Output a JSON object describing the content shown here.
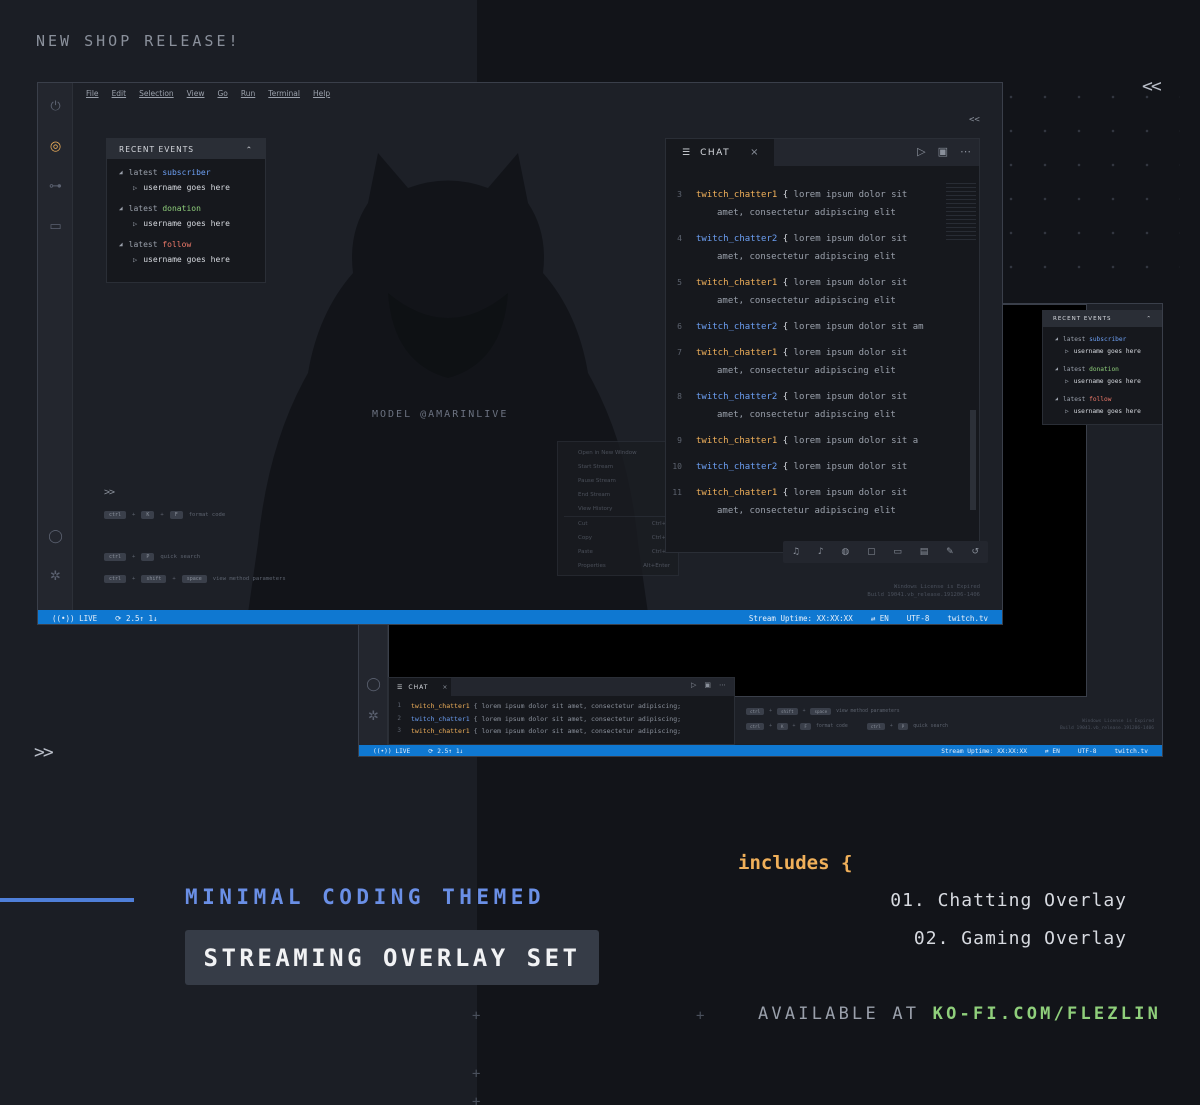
{
  "promo": {
    "top_label": "NEW SHOP RELEASE!",
    "chevron_left": "<<",
    "chevron_right": ">>",
    "theme_title": "MINIMAL CODING THEMED",
    "set_title": "STREAMING OVERLAY SET",
    "includes_label": "includes {",
    "includes_items": [
      "01. Chatting Overlay",
      "02. Gaming Overlay"
    ],
    "available_prefix": "AVAILABLE AT ",
    "available_url": "KO-FI.COM/FLEZLIN",
    "accent_color": "#6a8fe6",
    "orange_color": "#f0b05a",
    "green_color": "#8fcf7b"
  },
  "window_a": {
    "menu": [
      "File",
      "Edit",
      "Selection",
      "View",
      "Go",
      "Run",
      "Terminal",
      "Help"
    ],
    "activity_icons": [
      "power-icon",
      "webcam-icon",
      "gamepad-icon",
      "inbox-icon",
      "account-icon",
      "settings-icon"
    ],
    "model_tag": "MODEL @AMARINLIVE",
    "collapse_icon": "<<",
    "events": {
      "header": "RECENT EVENTS",
      "items": [
        {
          "prefix": "latest ",
          "type": "subscriber",
          "value": "username goes here"
        },
        {
          "prefix": "latest ",
          "type": "donation",
          "value": "username goes here"
        },
        {
          "prefix": "latest ",
          "type": "follow",
          "value": "username goes here"
        }
      ]
    },
    "prompt": ">>",
    "shortcuts": [
      {
        "keys": [
          "ctrl",
          "K",
          "F"
        ],
        "label": "format code"
      },
      {
        "keys": [
          "ctrl",
          "P"
        ],
        "label": "quick search"
      },
      {
        "keys": [
          "ctrl",
          "shift",
          "space"
        ],
        "label": "view method parameters"
      }
    ],
    "context_menu": [
      {
        "label": "Open in New Window",
        "shortcut": ""
      },
      {
        "label": "Start Stream",
        "shortcut": ""
      },
      {
        "label": "Pause Stream",
        "shortcut": ""
      },
      {
        "label": "End Stream",
        "shortcut": ""
      },
      {
        "label": "View History",
        "shortcut": ""
      },
      {
        "label": "Cut",
        "shortcut": "Ctrl+X"
      },
      {
        "label": "Copy",
        "shortcut": "Ctrl+C"
      },
      {
        "label": "Paste",
        "shortcut": "Ctrl+V"
      },
      {
        "label": "Properties",
        "shortcut": "Alt+Enter"
      }
    ],
    "chat": {
      "tab_label": "CHAT",
      "close_icon": "×",
      "lines": [
        {
          "n": "3",
          "user": "twitch_chatter1",
          "text": "lorem  ipsum dolor sit",
          "cont": "amet, consectetur adipiscing elit"
        },
        {
          "n": "4",
          "user": "twitch_chatter2",
          "text": "lorem  ipsum dolor sit",
          "cont": "amet, consectetur adipiscing elit"
        },
        {
          "n": "5",
          "user": "twitch_chatter1",
          "text": "lorem  ipsum dolor sit",
          "cont": "amet, consectetur adipiscing elit"
        },
        {
          "n": "6",
          "user": "twitch_chatter2",
          "text": "lorem ipsum dolor sit am",
          "cont": ""
        },
        {
          "n": "7",
          "user": "twitch_chatter1",
          "text": "lorem  ipsum dolor sit",
          "cont": "amet, consectetur adipiscing elit"
        },
        {
          "n": "8",
          "user": "twitch_chatter2",
          "text": "lorem  ipsum dolor sit",
          "cont": "amet, consectetur adipiscing elit"
        },
        {
          "n": "9",
          "user": "twitch_chatter1",
          "text": "lorem ipsum dolor sit a",
          "cont": ""
        },
        {
          "n": "10",
          "user": "twitch_chatter2",
          "text": "lorem  ipsum dolor sit",
          "cont": ""
        },
        {
          "n": "11",
          "user": "twitch_chatter1",
          "text": "lorem  ipsum dolor sit",
          "cont": "amet, consectetur adipiscing elit"
        }
      ]
    },
    "license": [
      "Windows License is Expired",
      "Build 19041.vb_release.191206-1406"
    ],
    "status": {
      "live": "LIVE",
      "sync": "2.5↑ 1↓",
      "uptime": "Stream Uptime: XX:XX:XX",
      "lang": "EN",
      "encoding": "UTF-8",
      "site": "twitch.tv"
    }
  },
  "window_b": {
    "events": {
      "header": "RECENT EVENTS",
      "items": [
        {
          "prefix": "latest ",
          "type": "subscriber",
          "value": "username goes here"
        },
        {
          "prefix": "latest ",
          "type": "donation",
          "value": "username goes here"
        },
        {
          "prefix": "latest ",
          "type": "follow",
          "value": "username goes here"
        }
      ]
    },
    "chat": {
      "tab_label": "CHAT",
      "close_icon": "×",
      "lines": [
        {
          "n": "1",
          "user": "twitch_chatter1",
          "text": "lorem ipsum dolor sit amet, consectetur adipiscing;"
        },
        {
          "n": "2",
          "user": "twitch_chatter1",
          "text": "lorem ipsum dolor sit amet, consectetur adipiscing;"
        },
        {
          "n": "3",
          "user": "twitch_chatter1",
          "text": "lorem ipsum dolor sit amet, consectetur adipiscing;"
        }
      ]
    },
    "shortcuts": [
      {
        "keys": [
          "ctrl",
          "shift",
          "space"
        ],
        "label": "view method parameters"
      },
      {
        "keys": [
          "ctrl",
          "K",
          "F"
        ],
        "label": "format code"
      },
      {
        "keys": [
          "ctrl",
          "P"
        ],
        "label": "quick search"
      }
    ],
    "license": [
      "Windows License is Expired",
      "Build 19041.vb_release.191206-1406"
    ],
    "status": {
      "live": "LIVE",
      "sync": "2.5↑ 1↓",
      "uptime": "Stream Uptime: XX:XX:XX",
      "lang": "EN",
      "encoding": "UTF-8",
      "site": "twitch.tv"
    }
  }
}
